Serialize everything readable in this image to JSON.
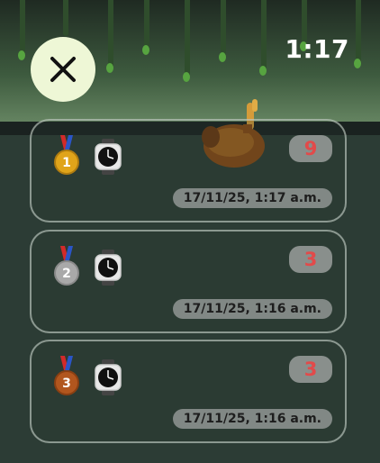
{
  "clock": "1:17",
  "close_icon": "close-icon",
  "entries": [
    {
      "rank": "1",
      "medal": "gold",
      "score": "9",
      "date": "17/11/25, 1:17 a.m."
    },
    {
      "rank": "2",
      "medal": "silver",
      "score": "3",
      "date": "17/11/25, 1:16 a.m."
    },
    {
      "rank": "3",
      "medal": "bronze",
      "score": "3",
      "date": "17/11/25, 1:16 a.m."
    }
  ],
  "colors": {
    "score_text": "#e24a4a",
    "gold": "#e0a41a",
    "silver": "#a9a9a9",
    "bronze": "#b1561e",
    "ribbon_red": "#d22a2a",
    "ribbon_blue": "#2a55c8"
  }
}
